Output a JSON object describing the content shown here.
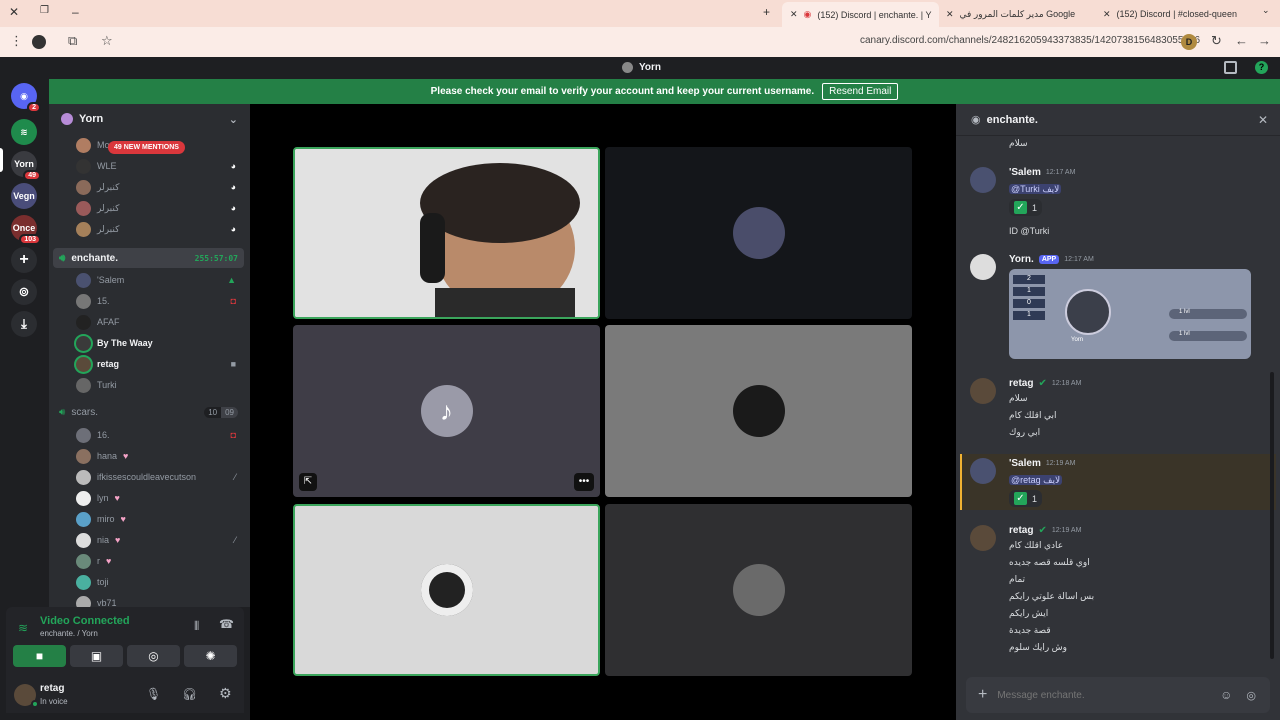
{
  "browser": {
    "tabs": [
      {
        "title": "(152) Discord | enchante. | Y",
        "active": true
      },
      {
        "title": "مدير كلمات المرور في Google",
        "active": false
      },
      {
        "title": "(152) Discord | #closed-queen",
        "active": false
      }
    ],
    "url": "canary.discord.com/channels/248216205943373835/1420738156483055676",
    "profile_initial": "D"
  },
  "app": {
    "title": "Yorn"
  },
  "banner": {
    "text": "Please check your email to verify your account and keep your current username.",
    "button": "Resend Email"
  },
  "guilds": [
    {
      "label": "",
      "badge": "2",
      "color": "#5865f2"
    },
    {
      "label": "",
      "badge": "",
      "color": "#1f8b4c"
    },
    {
      "label": "Yorn",
      "badge": "49",
      "color": "#3a3b40"
    },
    {
      "label": "Vegn",
      "badge": "",
      "color": "#4a4d7a"
    },
    {
      "label": "Once",
      "badge": "103",
      "color": "#7a2e2e"
    }
  ],
  "server": {
    "name": "Yorn",
    "mentions_badge": "49 NEW MENTIONS"
  },
  "top_members": [
    {
      "name": "Mo",
      "color": "#b07d62"
    },
    {
      "name": "WLE",
      "color": "#333"
    },
    {
      "name": "كنبرلر",
      "color": "#8a6a5a"
    },
    {
      "name": "كنبرلر",
      "color": "#9a5a5a"
    },
    {
      "name": "كنبرلر",
      "color": "#a5805a"
    }
  ],
  "voice_channels": [
    {
      "name": "enchante.",
      "timer": "255:57:07",
      "members": [
        {
          "name": "'Salem",
          "bold": false
        },
        {
          "name": "15.",
          "bold": false
        },
        {
          "name": "AFAF",
          "bold": false
        },
        {
          "name": "By The Waay",
          "bold": true
        },
        {
          "name": "retag",
          "bold": true
        },
        {
          "name": "Turki",
          "bold": false
        }
      ]
    },
    {
      "name": "scars.",
      "count_a": "10",
      "count_b": "09",
      "members": [
        {
          "name": "16."
        },
        {
          "name": "hana"
        },
        {
          "name": "ifkissescouldleavecutson"
        },
        {
          "name": "lyn"
        },
        {
          "name": "miro"
        },
        {
          "name": "nia"
        },
        {
          "name": "r"
        },
        {
          "name": "toji"
        },
        {
          "name": "vb71"
        }
      ]
    }
  ],
  "voice_panel": {
    "status": "Video Connected",
    "location": "enchante. / Yorn"
  },
  "user_panel": {
    "name": "retag",
    "status": "In voice"
  },
  "chat": {
    "channel": "enchante.",
    "input_placeholder": "Message enchante.",
    "top_snippet": "سلام",
    "messages": [
      {
        "author": "'Salem",
        "time": "12:17 AM",
        "lines": [
          "@Turki لايف"
        ],
        "reaction": "1",
        "extra": "ID @Turki"
      },
      {
        "author": "Yorn.",
        "app": "APP",
        "time": "12:17 AM",
        "card": {
          "stats": [
            [
              "",
              "2"
            ],
            [
              "",
              "1"
            ],
            [
              "",
              "0"
            ],
            [
              "",
              "1"
            ]
          ],
          "level_a": "1 lvl",
          "level_b": "1 lvl",
          "name": "Yorn"
        }
      },
      {
        "author": "retag",
        "time": "12:18 AM",
        "lines": [
          "سلام",
          "ابي اقلك كام",
          "ابي روك"
        ]
      },
      {
        "author": "'Salem",
        "time": "12:19 AM",
        "lines": [
          "@retag لايف"
        ],
        "reaction": "1",
        "highlight": true
      },
      {
        "author": "retag",
        "time": "12:19 AM",
        "lines": [
          "عادي اقلك كام",
          "اوي قلسه قصه جديده",
          "تمام",
          "بس اسالة علوتي رايكم",
          "ايش رايكم",
          "قصة جديدة",
          "وش رايك سلوم"
        ]
      }
    ]
  }
}
